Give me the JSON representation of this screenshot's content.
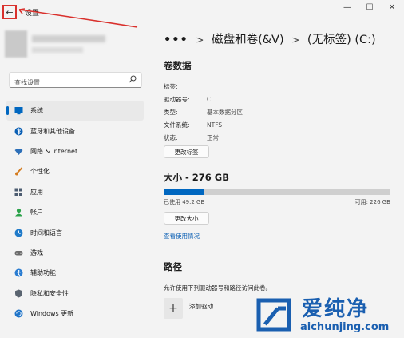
{
  "window": {
    "title": "设置",
    "back_glyph": "←",
    "controls": {
      "minimize": "—",
      "maximize": "☐",
      "close": "✕"
    }
  },
  "search": {
    "placeholder": "查找设置"
  },
  "sidebar": {
    "items": [
      {
        "label": "系统",
        "icon": "monitor-icon",
        "color": "#0067c0",
        "active": true
      },
      {
        "label": "蓝牙和其他设备",
        "icon": "bluetooth-icon",
        "color": "#0a5fb4"
      },
      {
        "label": "网络 & Internet",
        "icon": "wifi-icon",
        "color": "#2c6fb8"
      },
      {
        "label": "个性化",
        "icon": "brush-icon",
        "color": "#d47b1e"
      },
      {
        "label": "应用",
        "icon": "apps-icon",
        "color": "#4c5c70"
      },
      {
        "label": "帐户",
        "icon": "person-icon",
        "color": "#2aa24a"
      },
      {
        "label": "时间和语言",
        "icon": "globe-clock-icon",
        "color": "#1f7ac9"
      },
      {
        "label": "游戏",
        "icon": "gamepad-icon",
        "color": "#6b6b6b"
      },
      {
        "label": "辅助功能",
        "icon": "accessibility-icon",
        "color": "#2a7cd1"
      },
      {
        "label": "隐私和安全性",
        "icon": "shield-icon",
        "color": "#5a6470"
      },
      {
        "label": "Windows 更新",
        "icon": "update-icon",
        "color": "#1e73c8"
      }
    ]
  },
  "breadcrumb": {
    "overflow": "•••",
    "sep": ">",
    "parent": "磁盘和卷(&V)",
    "current": "(无标签) (C:)"
  },
  "volume_data": {
    "title": "卷数据",
    "rows": [
      {
        "key": "标签:",
        "value": ""
      },
      {
        "key": "驱动器号:",
        "value": "C"
      },
      {
        "key": "类型:",
        "value": "基本数据分区"
      },
      {
        "key": "文件系统:",
        "value": "NTFS"
      },
      {
        "key": "状态:",
        "value": "正常"
      }
    ],
    "change_label_button": "更改标签"
  },
  "size": {
    "title": "大小 - 276 GB",
    "used_fraction": 0.178,
    "used_text": "已使用 49.2 GB",
    "available_text": "可用: 226 GB",
    "change_size_button": "更改大小",
    "usage_link": "查看使用情况"
  },
  "paths": {
    "title": "路径",
    "description": "允许使用下列驱动器号和路径访问此卷。",
    "add_icon": "+",
    "add_label": "添加驱动"
  },
  "watermark": {
    "logo": "aichunjing-logo",
    "text": "爱纯净",
    "url": "aichunjing.com",
    "color": "#1a5fb0"
  }
}
